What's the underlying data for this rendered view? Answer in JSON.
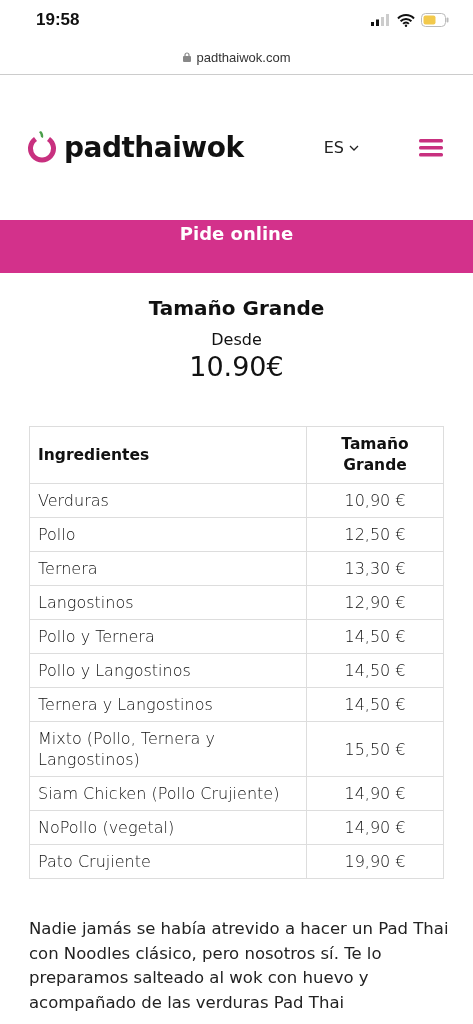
{
  "status_bar": {
    "time": "19:58"
  },
  "browser": {
    "url": "padthaiwok.com"
  },
  "header": {
    "logo": "padthaiwok",
    "language": "ES"
  },
  "banner": {
    "title": "Pide online"
  },
  "product": {
    "title": "Tamaño Grande",
    "from_label": "Desde",
    "price": "10.90€"
  },
  "table": {
    "columns": [
      "Ingredientes",
      "Tamaño Grande"
    ],
    "rows": [
      {
        "ingredient": "Verduras",
        "price": "10,90 €"
      },
      {
        "ingredient": "Pollo",
        "price": "12,50 €"
      },
      {
        "ingredient": "Ternera",
        "price": "13,30 €"
      },
      {
        "ingredient": "Langostinos",
        "price": "12,90 €"
      },
      {
        "ingredient": "Pollo y Ternera",
        "price": "14,50 €"
      },
      {
        "ingredient": "Pollo y Langostinos",
        "price": "14,50 €"
      },
      {
        "ingredient": "Ternera y Langostinos",
        "price": "14,50 €"
      },
      {
        "ingredient": "Mixto (Pollo, Ternera y Langostinos)",
        "price": "15,50 €"
      },
      {
        "ingredient": "Siam Chicken (Pollo Crujiente)",
        "price": "14,90 €"
      },
      {
        "ingredient": "NoPollo (vegetal)",
        "price": "14,90 €"
      },
      {
        "ingredient": "Pato Crujiente",
        "price": "19,90 €"
      }
    ]
  },
  "description": "Nadie jamás se había atrevido a hacer un Pad Thai con Noodles clásico, pero nosotros sí. Te lo preparamos salteado al wok con huevo y acompañado de las verduras Pad Thai"
}
